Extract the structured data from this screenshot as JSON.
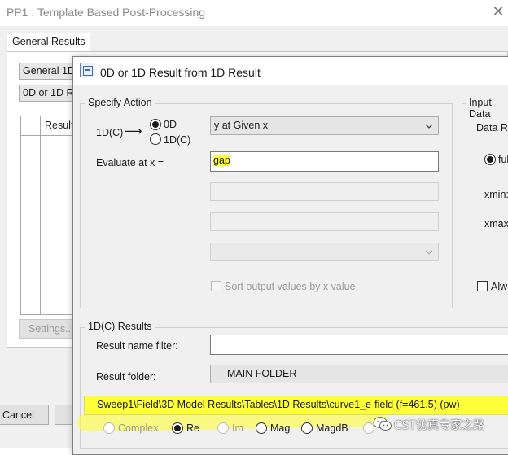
{
  "background_window": {
    "title": "PP1 : Template Based Post-Processing",
    "close_glyph": "✕",
    "tab_label": "General Results",
    "field1_value": "General 1D",
    "field2_value": "0D or 1D R",
    "list_header": "Result",
    "settings_label": "Settings...",
    "cancel_label": "Cancel"
  },
  "dialog": {
    "title": "0D or 1D Result from 1D Result",
    "icon": "template-window-icon",
    "specify_action": {
      "group_title": "Specify Action",
      "source_label": "1D(C)",
      "arrow": "⟶",
      "radio_0d": "0D",
      "radio_1dc": "1D(C)",
      "selected_radio": "0D",
      "operation_value": "y at Given x",
      "evaluate_label": "Evaluate at x =",
      "evaluate_value": "gap",
      "sort_label": "Sort output values by x value"
    },
    "input_data": {
      "group_title": "Input Data",
      "data_label": "Data R",
      "radio_label": "ful",
      "xmin_label": "xmin:",
      "xmax_label": "xmax",
      "always_label": "Alw"
    },
    "results": {
      "group_title": "1D(C) Results",
      "name_filter_label": "Result name filter:",
      "name_filter_value": "",
      "folder_label": "Result folder:",
      "folder_value": "— MAIN FOLDER —",
      "selected_path": "Sweep1\\Field\\3D Model Results\\Tables\\1D Results\\curve1_e-field (f=461.5) (pw)",
      "options": [
        {
          "label": "Complex",
          "checked": false,
          "disabled": true
        },
        {
          "label": "Re",
          "checked": true,
          "disabled": false
        },
        {
          "label": "Im",
          "checked": false,
          "disabled": true
        },
        {
          "label": "Mag",
          "checked": false,
          "disabled": false
        },
        {
          "label": "MagdB",
          "checked": false,
          "disabled": false
        }
      ]
    }
  },
  "watermark": {
    "text": "CST仿真专家之路",
    "icon": "wechat-icon"
  },
  "colors": {
    "highlight": "#ffff3a",
    "window_bg": "#f0f0f0"
  }
}
